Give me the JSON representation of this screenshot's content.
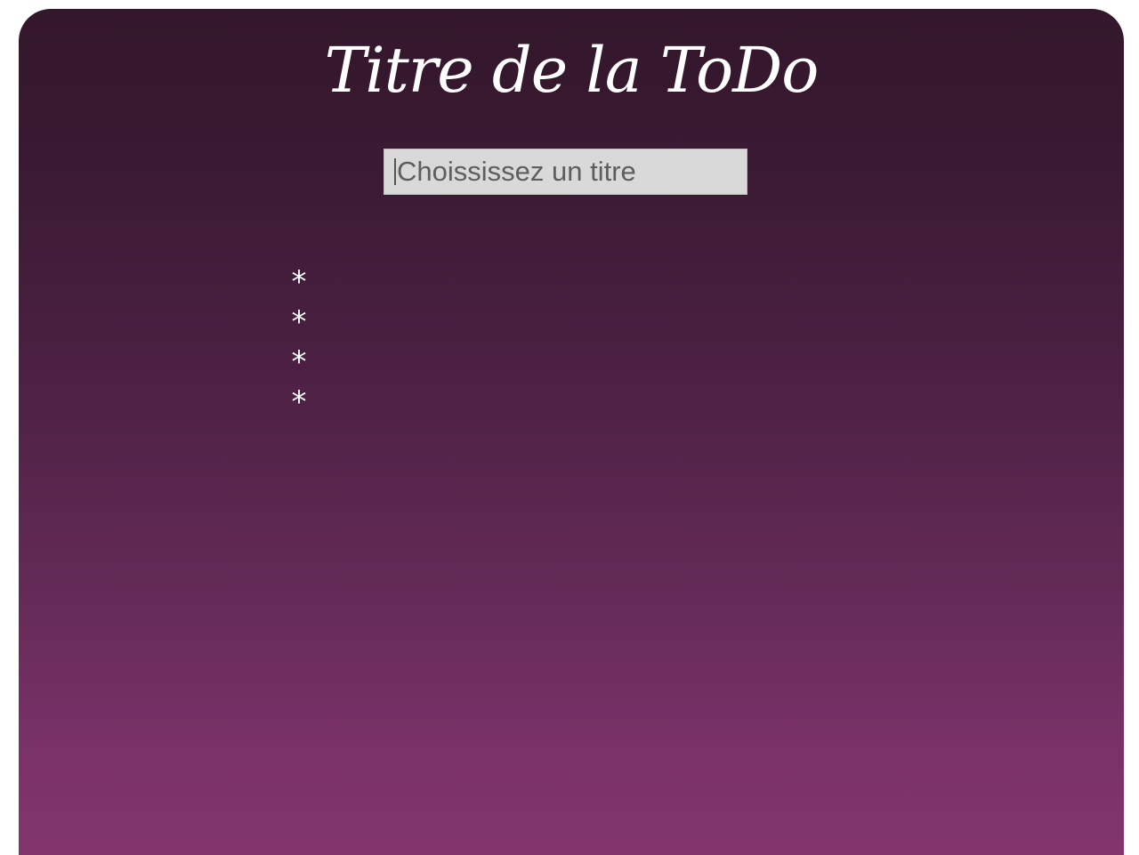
{
  "page": {
    "title": "Titre de la ToDo"
  },
  "title_input": {
    "placeholder": "Choississez un titre",
    "value": ""
  },
  "todo": {
    "items": [
      {
        "bullet": "*",
        "text": ""
      },
      {
        "bullet": "*",
        "text": ""
      },
      {
        "bullet": "*",
        "text": ""
      },
      {
        "bullet": "*",
        "text": ""
      }
    ]
  },
  "colors": {
    "background_top": "#33172b",
    "background_bottom": "#82356d",
    "input_background": "#d9d9d9",
    "text": "#ffffff"
  }
}
